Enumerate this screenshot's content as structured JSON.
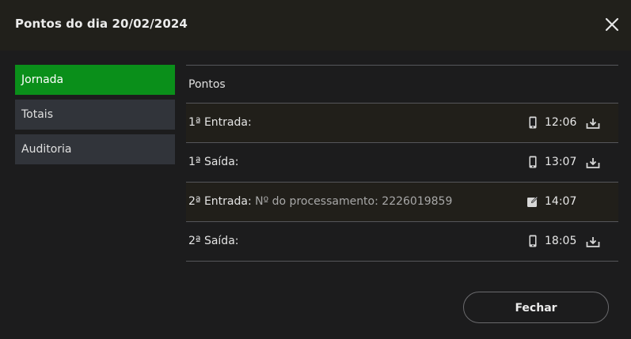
{
  "header": {
    "title": "Pontos do dia 20/02/2024",
    "close_icon": "close-icon"
  },
  "sidebar": {
    "items": [
      {
        "label": "Jornada",
        "active": true
      },
      {
        "label": "Totais",
        "active": false
      },
      {
        "label": "Auditoria",
        "active": false
      }
    ]
  },
  "content": {
    "section_title": "Pontos",
    "rows": [
      {
        "label": "1ª Entrada:",
        "detail": "",
        "source_icon": "mobile-phone-icon",
        "time": "12:06",
        "action_icon": "download-icon"
      },
      {
        "label": "1ª Saída:",
        "detail": "",
        "source_icon": "mobile-phone-icon",
        "time": "13:07",
        "action_icon": "download-icon"
      },
      {
        "label": "2ª Entrada:",
        "detail": " Nº do processamento: 2226019859",
        "source_icon": "edit-icon",
        "time": "14:07",
        "action_icon": ""
      },
      {
        "label": "2ª Saída:",
        "detail": "",
        "source_icon": "mobile-phone-icon",
        "time": "18:05",
        "action_icon": "download-icon"
      }
    ]
  },
  "footer": {
    "close_label": "Fechar"
  },
  "colors": {
    "accent_green": "#0a8f1a",
    "header_bg": "#21201b",
    "body_bg": "#1c1c1d",
    "sidebar_item_bg": "#31343a"
  }
}
